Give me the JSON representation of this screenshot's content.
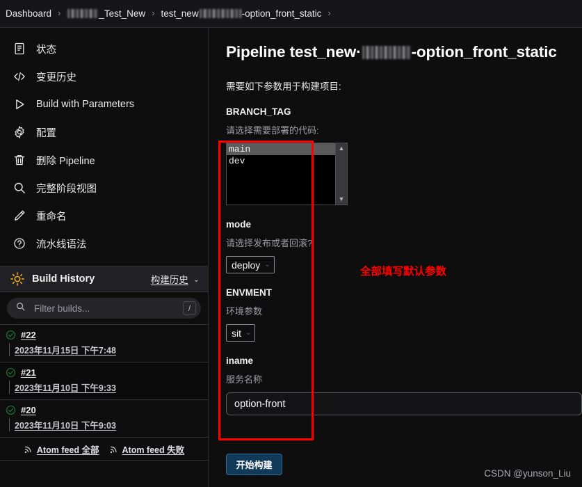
{
  "breadcrumb": {
    "items": [
      {
        "label": "Dashboard",
        "redacted": false
      },
      {
        "label": "_Test_New",
        "redacted": true
      },
      {
        "label": "test_new",
        "suffix": "-option_front_static",
        "redacted": true
      }
    ],
    "separator": "›"
  },
  "sidebar": {
    "items": [
      {
        "label": "状态",
        "icon": "document-icon"
      },
      {
        "label": "变更历史",
        "icon": "code-icon"
      },
      {
        "label": "Build with Parameters",
        "icon": "play-icon"
      },
      {
        "label": "配置",
        "icon": "gear-icon"
      },
      {
        "label": "删除 Pipeline",
        "icon": "trash-icon"
      },
      {
        "label": "完整阶段视图",
        "icon": "search-icon"
      },
      {
        "label": "重命名",
        "icon": "pencil-icon"
      },
      {
        "label": "流水线语法",
        "icon": "question-circle-icon"
      }
    ],
    "build_history": {
      "title": "Build History",
      "icon": "sun-icon",
      "link_label": "构建历史",
      "chevron": "⌄",
      "filter_placeholder": "Filter builds...",
      "filter_value": "",
      "filter_icon": "search-icon",
      "shortcut_key": "/",
      "builds": [
        {
          "number": "#22",
          "date": "2023年11月15日 下午7:48",
          "status": "success"
        },
        {
          "number": "#21",
          "date": "2023年11月10日 下午9:33",
          "status": "success"
        },
        {
          "number": "#20",
          "date": "2023年11月10日 下午9:03",
          "status": "success"
        }
      ],
      "feeds": [
        {
          "label": "Atom feed 全部",
          "icon": "rss-icon"
        },
        {
          "label": "Atom feed 失败",
          "icon": "rss-icon"
        }
      ]
    }
  },
  "main": {
    "title_prefix": "Pipeline test_new·",
    "title_suffix": "-option_front_static",
    "intro": "需要如下参数用于构建项目:",
    "params": {
      "branch_tag": {
        "name": "BRANCH_TAG",
        "desc": "请选择需要部署的代码:",
        "options": [
          "main",
          "dev"
        ],
        "selected": "main",
        "scroll_up": "▲",
        "scroll_down": "▼"
      },
      "mode": {
        "name": "mode",
        "desc": "请选择发布或者回滚?",
        "value": "deploy",
        "caret": "⌄"
      },
      "envment": {
        "name": "ENVMENT",
        "desc": "环境参数",
        "value": "sit",
        "caret": "⌄"
      },
      "iname": {
        "name": "iname",
        "desc": "服务名称",
        "value": "option-front",
        "placeholder": ""
      }
    },
    "submit_label": "开始构建"
  },
  "annotations": {
    "note": "全部填写默认参数",
    "note_color": "#fe0000",
    "box_color": "#fe0000"
  },
  "watermark": "CSDN @yunson_Liu"
}
